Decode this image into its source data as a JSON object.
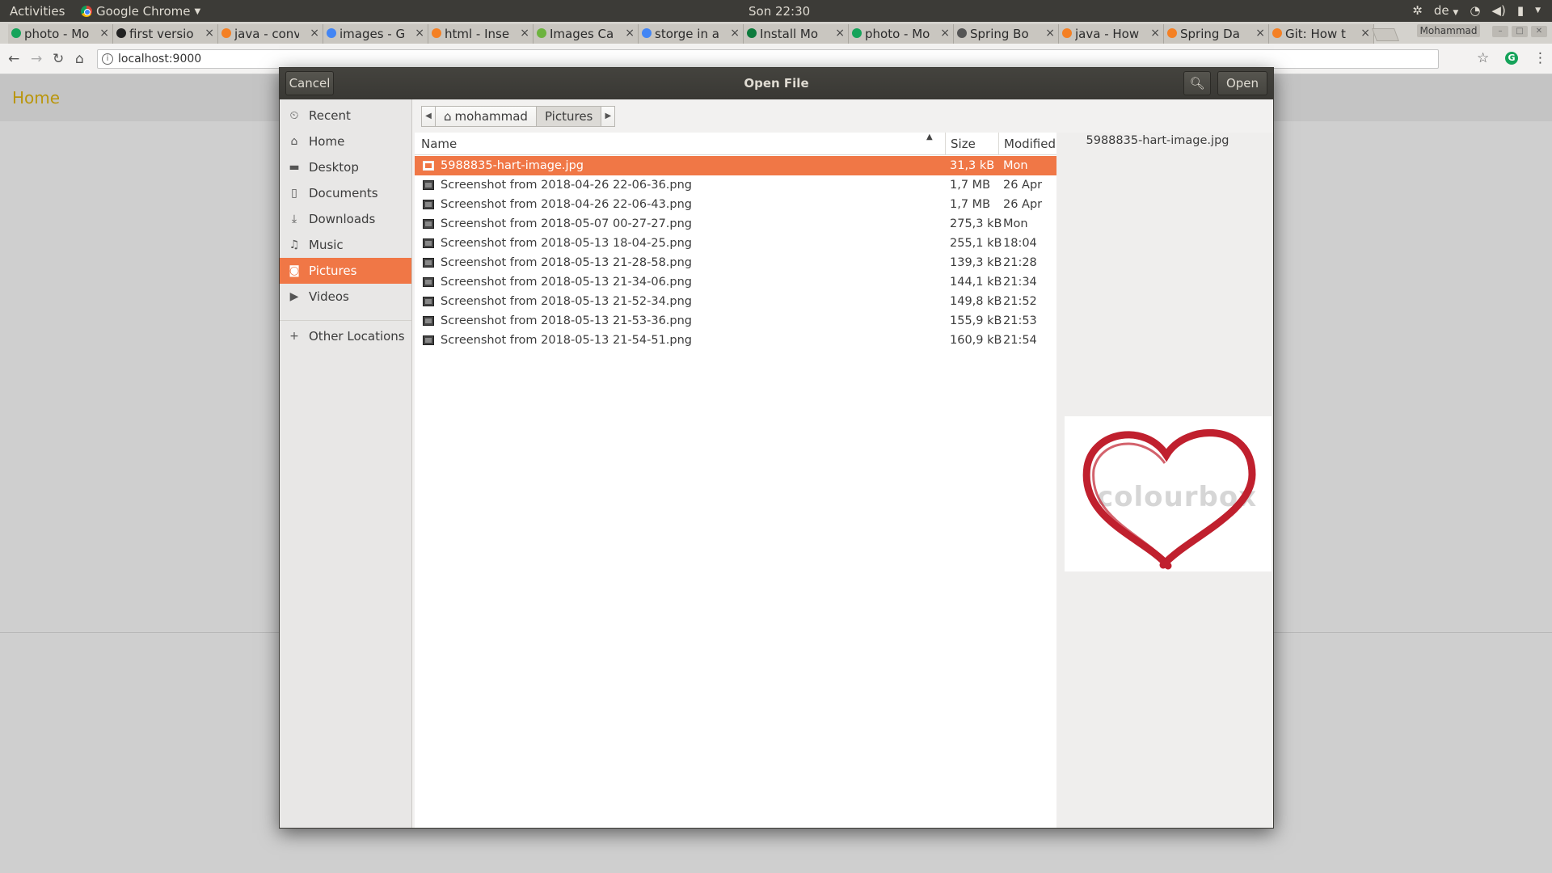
{
  "top_panel": {
    "activities": "Activities",
    "app_name": "Google Chrome",
    "clock": "Son 22:30",
    "keyboard_layout": "de"
  },
  "tabs": [
    {
      "title": "photo - Mo",
      "favicon": "green-circle",
      "color": "#15a35a"
    },
    {
      "title": "first versio",
      "favicon": "github-icon",
      "color": "#222222"
    },
    {
      "title": "java - conv",
      "favicon": "stackoverflow-icon",
      "color": "#f48024"
    },
    {
      "title": "images - G",
      "favicon": "google-icon",
      "color": "#4285f4"
    },
    {
      "title": "html - Inse",
      "favicon": "stackoverflow-icon",
      "color": "#f48024"
    },
    {
      "title": "Images Ca",
      "favicon": "spring-leaf-icon",
      "color": "#6db33f"
    },
    {
      "title": "storge in a",
      "favicon": "google-icon",
      "color": "#4285f4"
    },
    {
      "title": "Install Mo",
      "favicon": "mongodb-icon",
      "color": "#0d7a3c"
    },
    {
      "title": "photo - Mo",
      "favicon": "green-circle",
      "color": "#15a35a"
    },
    {
      "title": "Spring Bo",
      "favicon": "page-icon",
      "color": "#555555"
    },
    {
      "title": "java - How",
      "favicon": "stackoverflow-icon",
      "color": "#f48024"
    },
    {
      "title": "Spring Da",
      "favicon": "stackoverflow-icon",
      "color": "#f48024"
    },
    {
      "title": "Git: How t",
      "favicon": "stackoverflow-icon",
      "color": "#f48024"
    }
  ],
  "profile_name": "Mohammad",
  "address_bar": {
    "url": "localhost:9000"
  },
  "page": {
    "nav_home": "Home"
  },
  "dialog": {
    "title": "Open File",
    "cancel_label": "Cancel",
    "open_label": "Open",
    "accent_color": "#f07746",
    "places": [
      {
        "label": "Recent",
        "icon": "clock-icon",
        "glyph": "⏲"
      },
      {
        "label": "Home",
        "icon": "home-icon",
        "glyph": "⌂"
      },
      {
        "label": "Desktop",
        "icon": "folder-icon",
        "glyph": "▬"
      },
      {
        "label": "Documents",
        "icon": "document-icon",
        "glyph": "▯"
      },
      {
        "label": "Downloads",
        "icon": "download-icon",
        "glyph": "⤓"
      },
      {
        "label": "Music",
        "icon": "music-icon",
        "glyph": "♫"
      },
      {
        "label": "Pictures",
        "icon": "camera-icon",
        "glyph": "◙",
        "selected": true
      },
      {
        "label": "Videos",
        "icon": "video-icon",
        "glyph": "▶"
      }
    ],
    "other_locations": "Other Locations",
    "path": [
      "mohammad",
      "Pictures"
    ],
    "columns": {
      "name": "Name",
      "size": "Size",
      "modified": "Modified"
    },
    "files": [
      {
        "name": "5988835-hart-image.jpg",
        "size": "31,3 kB",
        "modified": "Mon",
        "selected": true
      },
      {
        "name": "Screenshot from 2018-04-26 22-06-36.png",
        "size": "1,7 MB",
        "modified": "26 Apr"
      },
      {
        "name": "Screenshot from 2018-04-26 22-06-43.png",
        "size": "1,7 MB",
        "modified": "26 Apr"
      },
      {
        "name": "Screenshot from 2018-05-07 00-27-27.png",
        "size": "275,3 kB",
        "modified": "Mon"
      },
      {
        "name": "Screenshot from 2018-05-13 18-04-25.png",
        "size": "255,1 kB",
        "modified": "18:04"
      },
      {
        "name": "Screenshot from 2018-05-13 21-28-58.png",
        "size": "139,3 kB",
        "modified": "21:28"
      },
      {
        "name": "Screenshot from 2018-05-13 21-34-06.png",
        "size": "144,1 kB",
        "modified": "21:34"
      },
      {
        "name": "Screenshot from 2018-05-13 21-52-34.png",
        "size": "149,8 kB",
        "modified": "21:52"
      },
      {
        "name": "Screenshot from 2018-05-13 21-53-36.png",
        "size": "155,9 kB",
        "modified": "21:53"
      },
      {
        "name": "Screenshot from 2018-05-13 21-54-51.png",
        "size": "160,9 kB",
        "modified": "21:54"
      }
    ],
    "preview": {
      "filename": "5988835-hart-image.jpg",
      "watermark": "colourbox",
      "heart_color": "#c0202e"
    }
  }
}
